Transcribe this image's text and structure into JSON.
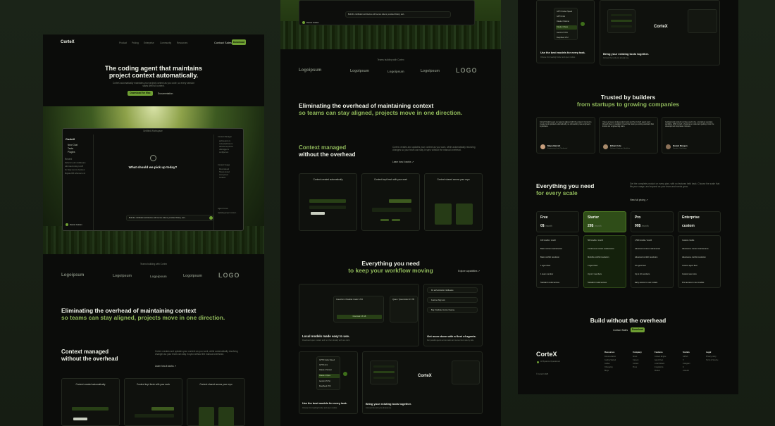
{
  "brand": "CorteX",
  "nav": {
    "items": [
      "Product",
      "Pricing",
      "Enterprise",
      "Community",
      "Resources"
    ],
    "contact": "Contact Sales",
    "cta": "Download"
  },
  "hero": {
    "title": "The coding agent that maintains project context automatically.",
    "sub": "CorteX automatically maintains your project context as you code, so every session starts with full context.",
    "primary": "Download for Mac",
    "secondary": "Documentation"
  },
  "app": {
    "title": "Untitled Workspace",
    "sidebar": [
      "New Chat",
      "Tasks",
      "Plugins"
    ],
    "recent_header": "Recent",
    "recent": [
      "Refactor auth middleware",
      "Add rate limiting to API",
      "Fix flaky test in checkout",
      "Migrate DB schema to v2"
    ],
    "prompt": "What should we pick up today?",
    "input": "Build the notification architecture with secure tokens, persisted history, and…",
    "user": "Daniel Golden",
    "files_header": "Context Manager",
    "files": [
      "auth/session.ts",
      "routes/api/index.ts",
      "db/schema.prisma",
      "utils/logger.ts",
      "config/env.ts"
    ],
    "stats_header": "Context Usage",
    "stats": [
      "Files indexed",
      "Tokens stored",
      "Last synced",
      "Conflicts"
    ],
    "agent_header": "Agent Focus",
    "agent": "Updating project context…"
  },
  "trusted_label": "Teams building with Cortex",
  "logos": [
    "Logoipsum",
    "Logoipsum",
    "Logoipsum",
    "Logoipsum",
    "LOGO"
  ],
  "overhead": {
    "l1": "Eliminating the overhead of maintaining context",
    "l2": "so teams can stay aligned, projects move in one direction."
  },
  "context": {
    "l1": "Context managed",
    "l2": "without the overhead",
    "body": "Cortex creates and updates your context as you work, while automatically resolving changes so your team can stay in sync without the manual overhead.",
    "link": "Learn how it works ↗",
    "cards": [
      "Context created automatically",
      "Context kept fresh with your work",
      "Context shared across your repo"
    ]
  },
  "workflow": {
    "l1": "Everything you need",
    "l2": "to keep your workflow moving",
    "link": "Explore capabilities ↗",
    "model_a": "Greenhorn / Basilisk Coder 6.5 B",
    "model_b": "Qwen / QwenCoder 3.5 7B",
    "download": "Download 6.5 GB",
    "local_t": "Local models made easy to use.",
    "local_s": "Download open models and run them locally with one click.",
    "agents": [
      "Fix authentication middleware",
      "Features flag tests",
      "Bug: Duplicate Invoice Cleanse"
    ],
    "fleet_t": "Get more done with a fleet of agents.",
    "fleet_s": "Run parallel agents across tasks and review them side by side.",
    "models": [
      "GPT-5 Codex Speed",
      "GPT-5 mini",
      "Claude 4 Sonnet",
      "Claude 4 Opus",
      "Gemini 2.5 Pro",
      "DeepSeek V3.2"
    ],
    "best_t": "Use the best models for every task.",
    "best_s": "Choose from leading frontier and open models.",
    "tools_t": "Bring your existing tools together.",
    "tools_s": "Connect the tools you already use."
  },
  "testimonials": {
    "l1": "Trusted by builders",
    "l2": "from startups to growing companies",
    "items": [
      {
        "quote": "CorteX finally keeps our agents aligned with the project. Context is created and updated automatically, so onboarding new engineers is painless.",
        "name": "Maya Barrett",
        "role": "Engineering Lead, Northwind"
      },
      {
        "quote": "I have all seven independent tools and the CorteX agent went through them in parallel. It feels like having a coding assistant that knows our engineering team.",
        "name": "Ethan Cole",
        "role": "Software Engineer, Brightline"
      },
      {
        "quote": "Getting local models running used to be a complete separate workflow. With CorteX, choosing a model and getting it into the development loop takes minutes.",
        "name": "Daniel Morgan",
        "role": "Founder, Stackforge"
      }
    ]
  },
  "pricing": {
    "l1": "Everything you need",
    "l2": "for every scale",
    "body": "Get the complete product on every plan, with no features held back. Choose the scale that fits your usage, and expand as your team and needs grow.",
    "link": "View full pricing ↗",
    "plans": [
      {
        "name": "Free",
        "price": "0$",
        "unit": "/month",
        "features": [
          "100 credits / month",
          "Basic context maintenance",
          "Basic conflict resolution",
          "1 agent fleet",
          "1 team member",
          "Standard model access"
        ]
      },
      {
        "name": "Starter",
        "price": "29$",
        "unit": "/month",
        "features": [
          "500 credits / month",
          "Continuous context maintenance",
          "Multi-file conflict resolution",
          "3 agent fleet",
          "Up to 3 members",
          "Standard model access"
        ]
      },
      {
        "name": "Pro",
        "price": "99$",
        "unit": "/month",
        "features": [
          "1,500 credits / month",
          "Advanced context maintenance",
          "Advanced conflict resolution",
          "10 agent fleet",
          "Up to 10 members",
          "Early access to new models"
        ]
      },
      {
        "name": "Enterprise",
        "price": "custom",
        "unit": "",
        "features": [
          "Custom credits",
          "Advanced+ context maintenance",
          "Advanced+ conflict resolution",
          "Custom agent fleet",
          "Custom team size",
          "First access to new models"
        ]
      }
    ]
  },
  "cta": {
    "title": "Build without the overhead",
    "contact": "Contact Sales",
    "download": "Download"
  },
  "footer": {
    "status": "All Systems Operational",
    "copy": "© CorteX 2025",
    "cols": [
      {
        "h": "Resources",
        "items": [
          "Documentation",
          "Getting Started",
          "Guides",
          "Changelog",
          "Blogs"
        ]
      },
      {
        "h": "Company",
        "items": [
          "About",
          "Careers",
          "Contact",
          "Press"
        ]
      },
      {
        "h": "Features",
        "items": [
          "Context Engine",
          "Agent Fleet",
          "Local Models",
          "Integrations",
          "Models"
        ]
      },
      {
        "h": "Socials",
        "items": [
          "GitHub",
          "X",
          "Instagram",
          "In",
          "LinkedIn"
        ]
      },
      {
        "h": "Legal",
        "items": [
          "Privacy policy",
          "Terms & Service"
        ]
      }
    ]
  }
}
